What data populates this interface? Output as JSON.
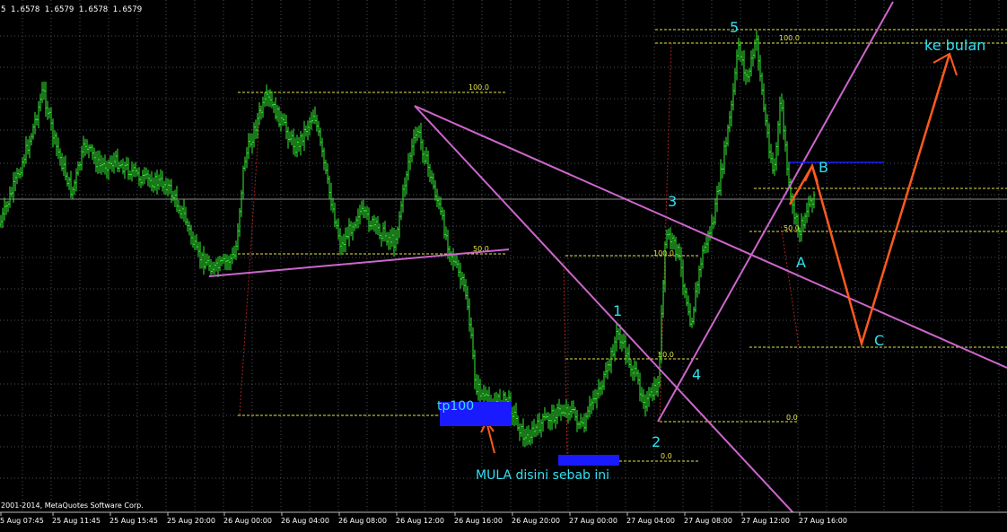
{
  "header": {
    "price_readout": "5  1.6578 1.6579 1.6578 1.6579",
    "copyright": "2001-2014, MetaQuotes Software Corp."
  },
  "chart_data": {
    "type": "candlestick",
    "x_tick_labels": [
      "5 Aug 07:45",
      "25 Aug 11:45",
      "25 Aug 15:45",
      "25 Aug 20:00",
      "26 Aug 00:00",
      "26 Aug 04:00",
      "26 Aug 08:00",
      "26 Aug 12:00",
      "26 Aug 16:00",
      "26 Aug 20:00",
      "27 Aug 00:00",
      "27 Aug 04:00",
      "27 Aug 08:00",
      "27 Aug 12:00",
      "27 Aug 16:00"
    ],
    "grid": true,
    "colors": {
      "background": "#000000",
      "candle": "#33ee33",
      "grid": "#556677",
      "trendline": "#cc66cc",
      "fibo": "#e6e64a",
      "fibo_vertical": "#aa2222",
      "projection": "#ff5a1e",
      "label_cyan": "#33e0f0",
      "blue_marker": "#1a1aff"
    },
    "fibo_levels": [
      {
        "label": "100.0"
      },
      {
        "label": "50.0"
      },
      {
        "label": "0.0"
      },
      {
        "label": "100.0"
      },
      {
        "label": "50.0"
      },
      {
        "label": "0.0"
      },
      {
        "label": "100.0"
      },
      {
        "label": "50.0"
      },
      {
        "label": "0.0"
      }
    ],
    "wave_labels": [
      "1",
      "2",
      "3",
      "4",
      "5",
      "A",
      "B",
      "C"
    ],
    "annotations": [
      "ke bulan",
      "tp100",
      "MULA disini sebab ini"
    ]
  }
}
